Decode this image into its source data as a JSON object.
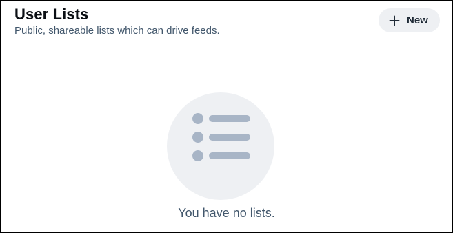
{
  "header": {
    "title": "User Lists",
    "subtitle": "Public, shareable lists which can drive feeds.",
    "new_button": {
      "label": "New",
      "icon": "plus-icon"
    }
  },
  "empty_state": {
    "icon": "list-icon",
    "message": "You have no lists."
  },
  "colors": {
    "title": "#0b0f14",
    "muted_text": "#42576c",
    "button_bg": "#eef0f3",
    "icon_gray": "#a8b5c6",
    "divider": "#dcdde2"
  }
}
